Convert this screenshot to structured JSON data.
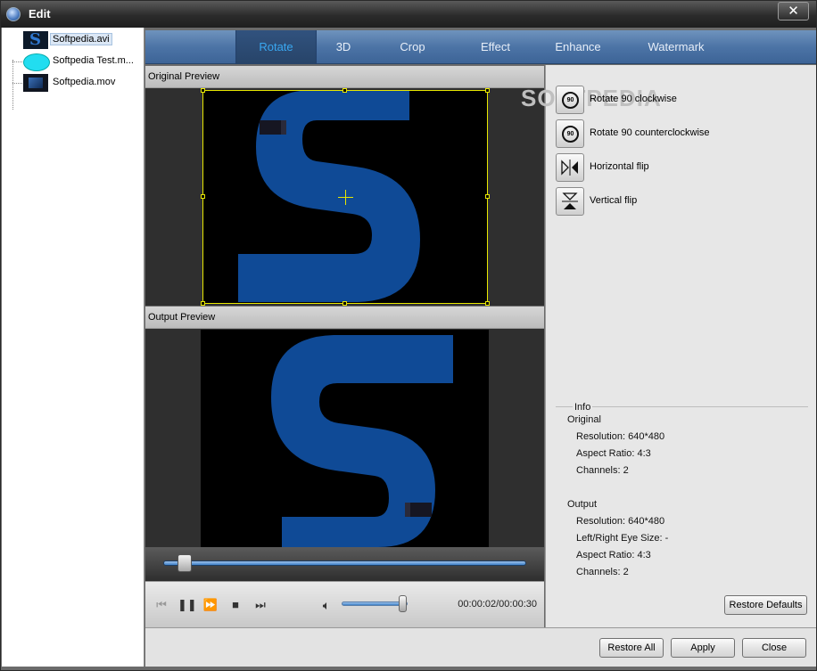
{
  "window": {
    "title": "Edit",
    "close_glyph": "✕"
  },
  "files": [
    {
      "name": "Softpedia.avi",
      "selected": true
    },
    {
      "name": "Softpedia Test.m...",
      "selected": false
    },
    {
      "name": "Softpedia.mov",
      "selected": false
    }
  ],
  "tabs": [
    {
      "label": "Rotate",
      "active": true
    },
    {
      "label": "3D",
      "active": false
    },
    {
      "label": "Crop",
      "active": false
    },
    {
      "label": "Effect",
      "active": false
    },
    {
      "label": "Enhance",
      "active": false
    },
    {
      "label": "Watermark",
      "active": false
    }
  ],
  "preview": {
    "original_label": "Original Preview",
    "output_label": "Output Preview",
    "seek_position": 0.06,
    "volume_level": 0.9,
    "time": "00:00:02/00:00:30"
  },
  "watermark_text": "SOFTPEDIA",
  "actions": [
    {
      "label": "Rotate 90 clockwise",
      "icon": "rotate-cw-icon",
      "glyph": "90"
    },
    {
      "label": "Rotate 90 counterclockwise",
      "icon": "rotate-ccw-icon",
      "glyph": "90"
    },
    {
      "label": "Horizontal flip",
      "icon": "horizontal-flip-icon"
    },
    {
      "label": "Vertical flip",
      "icon": "vertical-flip-icon"
    }
  ],
  "info": {
    "legend": "Info",
    "original_heading": "Original",
    "original": {
      "resolution": "Resolution: 640*480",
      "aspect": "Aspect Ratio: 4:3",
      "channels": "Channels: 2"
    },
    "output_heading": "Output",
    "output": {
      "resolution": "Resolution: 640*480",
      "eye_size": "Left/Right Eye Size: -",
      "aspect": "Aspect Ratio: 4:3",
      "channels": "Channels: 2"
    }
  },
  "buttons": {
    "restore_defaults": "Restore Defaults",
    "restore_all": "Restore All",
    "apply": "Apply",
    "close": "Close"
  },
  "colors": {
    "accent_tab_text": "#39a7f0",
    "tab_bar": "#4c74a6",
    "video_shape": "#0f4a96",
    "crop_frame": "#e8e800"
  }
}
